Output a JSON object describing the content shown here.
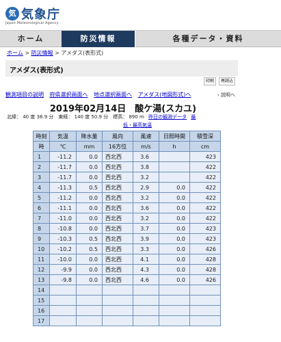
{
  "logo": {
    "mark": "気",
    "title": "気象庁",
    "subtitle": "Japan Meteorological Agency"
  },
  "nav": {
    "home": "ホーム",
    "bosai": "防災情報",
    "data": "各種データ・資料"
  },
  "breadcrumb": {
    "home": "ホーム",
    "sep1": ">",
    "bosai": "防災情報",
    "sep2": ">",
    "current": "アメダス(表形式)"
  },
  "page_title": "アメダス(表形式)",
  "buttons": {
    "print": "印刷",
    "reload": "再読込"
  },
  "links": [
    "観測項目の説明",
    "府県選択画面へ",
    "地点選択画面へ",
    "アメダス(地図形式)へ"
  ],
  "help": "説明へ",
  "main_title": "2019年02月14日　酸ケ湯(スカユ)",
  "station": {
    "info": "北緯： 40 度 38.9 分　東経： 140 度 50.9 分　標高： 890 m",
    "yesterday": "昨日の観測データ",
    "extreme_a": "最",
    "extreme_b": "低・最高気温"
  },
  "table": {
    "headers": [
      "時刻",
      "気温",
      "降水量",
      "風向",
      "風速",
      "日照時間",
      "積雪深"
    ],
    "units": [
      "時",
      "℃",
      "mm",
      "16方位",
      "m/s",
      "h",
      "cm"
    ],
    "rows": [
      [
        "1",
        "-11.2",
        "0.0",
        "西北西",
        "3.6",
        "",
        "423"
      ],
      [
        "2",
        "-11.7",
        "0.0",
        "西北西",
        "3.8",
        "",
        "422"
      ],
      [
        "3",
        "-11.7",
        "0.0",
        "西北西",
        "3.2",
        "",
        "422"
      ],
      [
        "4",
        "-11.3",
        "0.5",
        "西北西",
        "2.9",
        "0.0",
        "422"
      ],
      [
        "5",
        "-11.2",
        "0.0",
        "西北西",
        "3.2",
        "0.0",
        "422"
      ],
      [
        "6",
        "-11.1",
        "0.0",
        "西北西",
        "3.6",
        "0.0",
        "422"
      ],
      [
        "7",
        "-11.0",
        "0.0",
        "西北西",
        "3.2",
        "0.0",
        "422"
      ],
      [
        "8",
        "-10.8",
        "0.0",
        "西北西",
        "3.7",
        "0.0",
        "423"
      ],
      [
        "9",
        "-10.3",
        "0.5",
        "西北西",
        "3.9",
        "0.0",
        "423"
      ],
      [
        "10",
        "-10.2",
        "0.5",
        "西北西",
        "3.3",
        "0.0",
        "426"
      ],
      [
        "11",
        "-10.0",
        "0.0",
        "西北西",
        "4.1",
        "0.0",
        "428"
      ],
      [
        "12",
        "-9.9",
        "0.0",
        "西北西",
        "4.3",
        "0.0",
        "428"
      ],
      [
        "13",
        "-9.8",
        "0.0",
        "西北西",
        "4.6",
        "0.0",
        "426"
      ],
      [
        "14",
        "",
        "",
        "",
        "",
        "",
        ""
      ],
      [
        "15",
        "",
        "",
        "",
        "",
        "",
        ""
      ],
      [
        "16",
        "",
        "",
        "",
        "",
        "",
        ""
      ],
      [
        "17",
        "",
        "",
        "",
        "",
        "",
        ""
      ]
    ]
  },
  "colors": {
    "nav_active": "#1f3a5f",
    "table_header": "#c6d6ea",
    "table_cell": "#e7eef8",
    "table_border": "#6f8fb8",
    "link": "#0000cc"
  }
}
